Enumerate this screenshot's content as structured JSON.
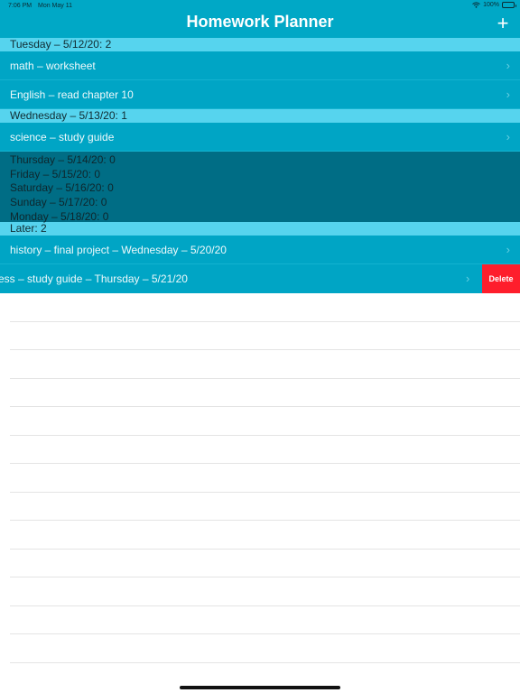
{
  "status": {
    "time": "7:06 PM",
    "date": "Mon May 11",
    "battery": "100%"
  },
  "nav": {
    "title": "Homework Planner",
    "add": "+"
  },
  "sections": {
    "tue": {
      "header": "Tuesday – 5/12/20: 2",
      "items": [
        "math – worksheet",
        "English – read chapter 10"
      ]
    },
    "wed": {
      "header": "Wednesday – 5/13/20: 1",
      "items": [
        "science – study guide"
      ]
    },
    "empty_days": [
      "Thursday – 5/14/20: 0",
      "Friday – 5/15/20: 0",
      "Saturday – 5/16/20: 0",
      "Sunday – 5/17/20: 0",
      "Monday – 5/18/20: 0"
    ],
    "later": {
      "header": "Later: 2",
      "items": [
        "history – final project – Wednesday – 5/20/20"
      ],
      "swiped_item": "ess – study guide – Thursday – 5/21/20",
      "delete_label": "Delete"
    }
  },
  "icons": {
    "chevron": "chevron-right-icon",
    "wifi": "wifi-icon",
    "battery": "battery-icon"
  },
  "colors": {
    "nav": "#00a8c6",
    "section_header": "#56d4ee",
    "row": "#00a5c5",
    "empty_block": "#006d85",
    "delete": "#fe1e2c"
  }
}
